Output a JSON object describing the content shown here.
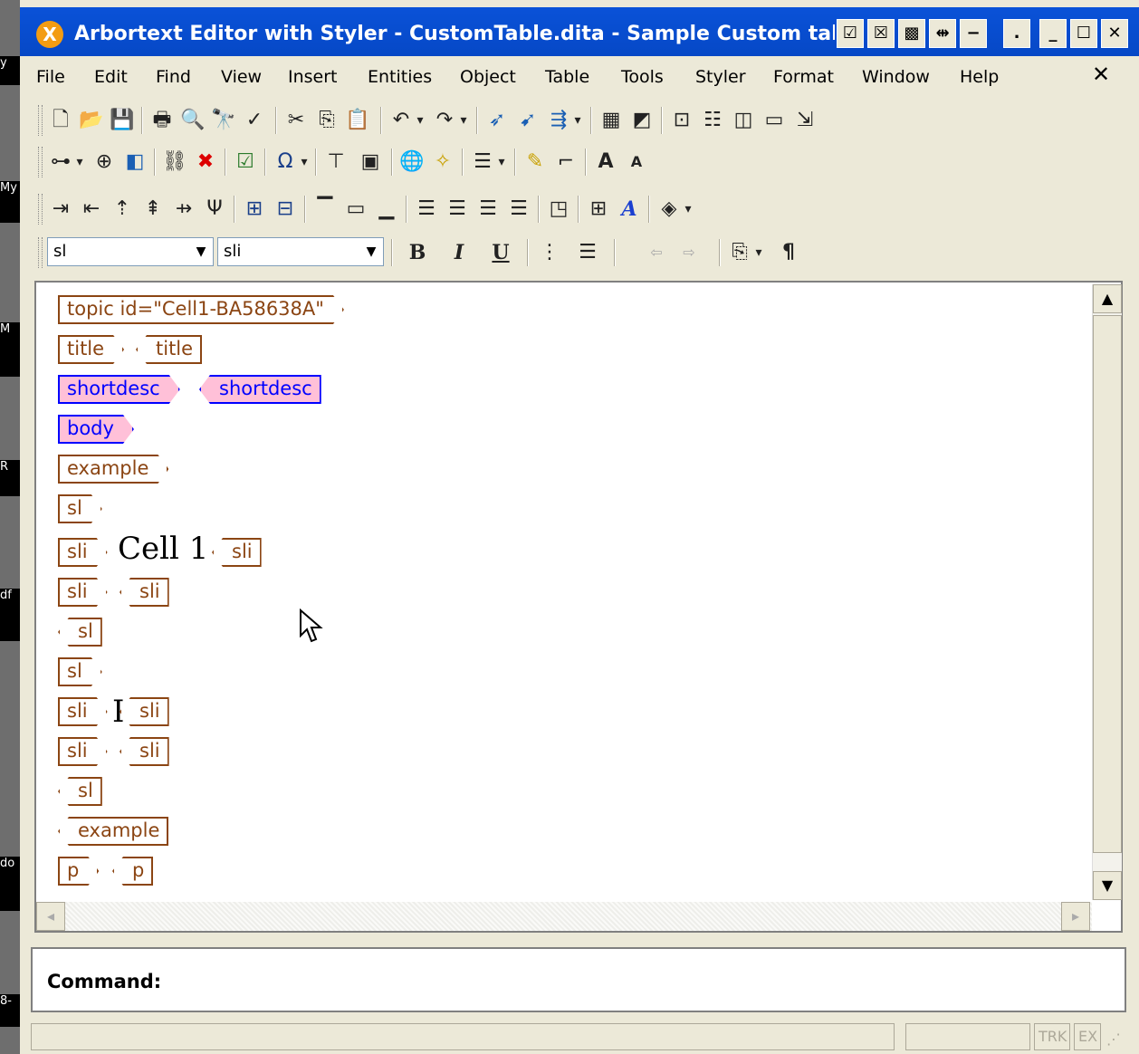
{
  "window": {
    "title": "Arbortext Editor with Styler - CustomTable.dita - Sample Custom tab",
    "logo_glyph": "X",
    "title_buttons": [
      "☑",
      "☒",
      "▩",
      "⇹",
      "−",
      ".",
      "_",
      "☐",
      "✕"
    ]
  },
  "left_strip_labels": [
    "y",
    "My",
    "M",
    "R",
    "df",
    "do",
    "8-"
  ],
  "menu": {
    "items": [
      "File",
      "Edit",
      "Find",
      "View",
      "Insert",
      "Entities",
      "Object",
      "Table",
      "Tools",
      "Styler",
      "Format",
      "Window",
      "Help"
    ],
    "close_glyph": "✕"
  },
  "toolbar_row1": [
    "new-file-icon",
    "open-icon",
    "save-icon",
    "print-icon",
    "print-preview-icon",
    "find-icon",
    "spellcheck-icon",
    "cut-icon",
    "copy-icon",
    "paste-icon",
    "undo-icon",
    "redo-icon",
    "insert-markup-icon",
    "change-markup-icon",
    "split-markup-icon",
    "table-icon",
    "object-icon",
    "zoom-icon",
    "doc-map-icon",
    "frame-icon",
    "layout-icon",
    "preview-icon"
  ],
  "toolbar_row2": [
    "tree-icon",
    "quick-search-icon",
    "layers-icon",
    "link-icon",
    "delete-markup-icon",
    "validate-icon",
    "special-char-icon",
    "insert-text-icon",
    "abc-icon",
    "globe-icon",
    "magic-wand-icon",
    "list-icon",
    "highlight-icon",
    "tag-icon",
    "font-bigger-icon",
    "font-smaller-icon"
  ],
  "toolbar_row3": [
    "row-insert-icon",
    "row-move-icon",
    "col-insert-icon",
    "col-move-icon",
    "cell-join-icon",
    "cell-split-icon",
    "table-props-icon",
    "table-align-icon",
    "align-top-icon",
    "align-middle-icon",
    "align-bottom-icon",
    "align-left-icon",
    "align-center-icon",
    "align-right-icon",
    "justify-icon",
    "cell-props-icon",
    "grid-icon",
    "font-style-icon",
    "fill-color-icon"
  ],
  "style_toolbar": {
    "element_combo": "sl",
    "context_combo": "sli",
    "bold": "B",
    "italic": "I",
    "underline": "U",
    "pilcrow": "¶"
  },
  "document_tags": [
    {
      "text": "topic id=\"Cell1-BA58638A\"",
      "kind": "start",
      "style": "normal"
    },
    {
      "text": "title",
      "kind": "start",
      "style": "normal"
    },
    {
      "text": "title",
      "kind": "end",
      "style": "normal"
    },
    {
      "text": "shortdesc",
      "kind": "start",
      "style": "pink"
    },
    {
      "text": "shortdesc",
      "kind": "end",
      "style": "pink"
    },
    {
      "text": "body",
      "kind": "start",
      "style": "pink"
    },
    {
      "text": "example",
      "kind": "start",
      "style": "normal"
    },
    {
      "text": "sl",
      "kind": "start",
      "style": "normal"
    },
    {
      "text": "sli",
      "kind": "start",
      "style": "normal"
    },
    {
      "text": "sli",
      "kind": "end",
      "style": "normal"
    },
    {
      "text": "sli",
      "kind": "start",
      "style": "normal"
    },
    {
      "text": "sli",
      "kind": "end",
      "style": "normal"
    },
    {
      "text": "sl",
      "kind": "end",
      "style": "normal"
    },
    {
      "text": "sl",
      "kind": "start",
      "style": "normal"
    },
    {
      "text": "sli",
      "kind": "start",
      "style": "normal"
    },
    {
      "text": "sli",
      "kind": "end",
      "style": "normal"
    },
    {
      "text": "sli",
      "kind": "start",
      "style": "normal"
    },
    {
      "text": "sli",
      "kind": "end",
      "style": "normal"
    },
    {
      "text": "sl",
      "kind": "end",
      "style": "normal"
    },
    {
      "text": "example",
      "kind": "end",
      "style": "normal"
    },
    {
      "text": "p",
      "kind": "start",
      "style": "normal"
    },
    {
      "text": "p",
      "kind": "end",
      "style": "normal"
    }
  ],
  "cell_text": "Cell 1",
  "command": {
    "label": "Command:"
  },
  "status": {
    "trk": "TRK",
    "ext": "EX"
  },
  "colors": {
    "titlebar": "#0a52d8",
    "tag_border": "#8b4513",
    "tag_pink_bg": "#ffc0d8",
    "tag_pink_fg": "#0000ff",
    "chrome": "#ece9d8"
  }
}
